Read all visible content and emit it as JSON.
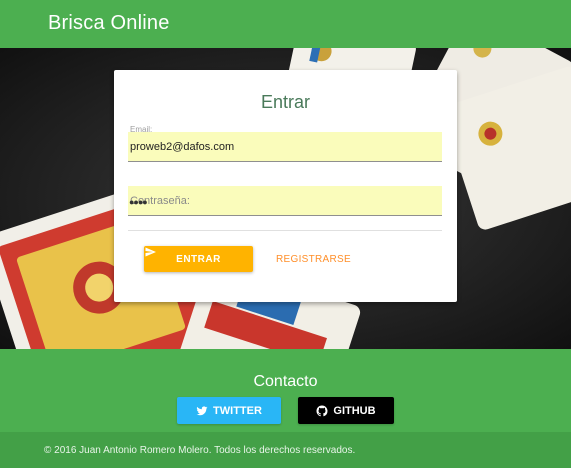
{
  "header": {
    "brand": "Brisca Online"
  },
  "login": {
    "title": "Entrar",
    "email_label": "Email:",
    "email_value": "proweb2@dafos.com",
    "password_placeholder": "Contraseña:",
    "enter_label": "ENTRAR",
    "register_label": "REGISTRARSE"
  },
  "contact": {
    "title": "Contacto",
    "twitter_label": "TWITTER",
    "github_label": "GITHUB"
  },
  "footer": {
    "copyright": "© 2016 Juan Antonio Romero Molero. Todos los derechos reservados."
  },
  "colors": {
    "primary_green": "#4caf50",
    "footer_green": "#43a047",
    "accent_amber": "#ffb300",
    "link_orange": "#ff8f2a",
    "twitter_blue": "#29b6f6",
    "github_black": "#000000",
    "autofill_yellow": "#fafcbb"
  },
  "icons": {
    "enter_button": "send-icon",
    "twitter_button": "twitter-icon",
    "github_button": "github-icon"
  }
}
